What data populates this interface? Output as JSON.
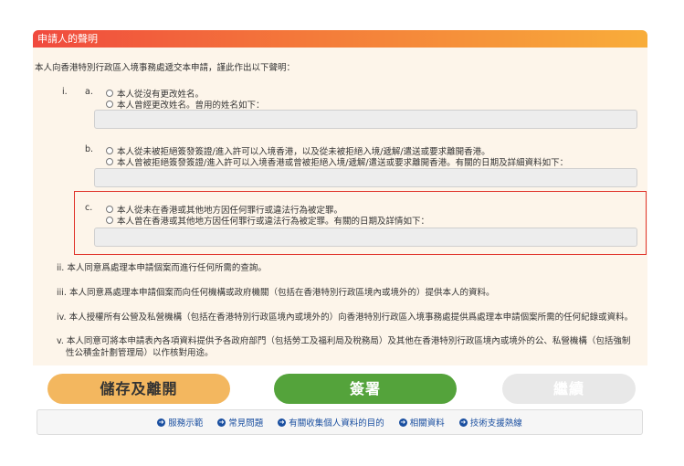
{
  "panel": {
    "title": "申請人的聲明",
    "intro": "本人向香港特別行政區入境事務處遞交本申請，謹此作出以下聲明："
  },
  "section_i": {
    "roman": "i.",
    "a": {
      "letter": "a.",
      "options": [
        "本人從沒有更改姓名。",
        "本人曾經更改姓名。曾用的姓名如下："
      ]
    },
    "b": {
      "letter": "b.",
      "options": [
        "本人從未被拒絕簽發簽證/進入許可以入境香港，以及從未被拒絕入境/遞解/遣送或要求離開香港。",
        "本人曾被拒絕簽發簽證/進入許可以入境香港或曾被拒絕入境/遞解/遣送或要求離開香港。有關的日期及詳細資料如下："
      ]
    },
    "c": {
      "letter": "c.",
      "options": [
        "本人從未在香港或其他地方因任何罪行或違法行為被定罪。",
        "本人曾在香港或其他地方因任何罪行或違法行為被定罪。有關的日期及詳情如下："
      ]
    }
  },
  "declarations": [
    "ii. 本人同意爲處理本申請個案而進行任何所需的查詢。",
    "iii. 本人同意爲處理本申請個案而向任何機構或政府機關（包括在香港特別行政區境內或境外的）提供本人的資料。",
    "iv. 本人授權所有公營及私營機構（包括在香港特別行政區境內或境外的）向香港特別行政區入境事務處提供爲處理本申請個案所需的任何紀錄或資料。",
    "v. 本人同意可將本申請表內各項資料提供予各政府部門（包括勞工及福利局及稅務局）及其他在香港特別行政區境內或境外的公、私營機構（包括強制",
    "性公積金計劃管理局）以作核對用途。"
  ],
  "buttons": {
    "save": "儲存及離開",
    "sign": "簽署",
    "next": "繼續"
  },
  "footer_links": [
    "服務示範",
    "常見問題",
    "有關收集個人資料的目的",
    "相關資料",
    "技術支援熱線"
  ],
  "colors": {
    "header_start": "#f04a3e",
    "header_end": "#f8ad3a",
    "panel_bg": "#fdf5ea",
    "highlight": "#e0332a",
    "save_btn": "#f3b75f",
    "sign_btn": "#54a33b",
    "next_btn": "#e8e8e8",
    "link": "#1a4fa0"
  }
}
